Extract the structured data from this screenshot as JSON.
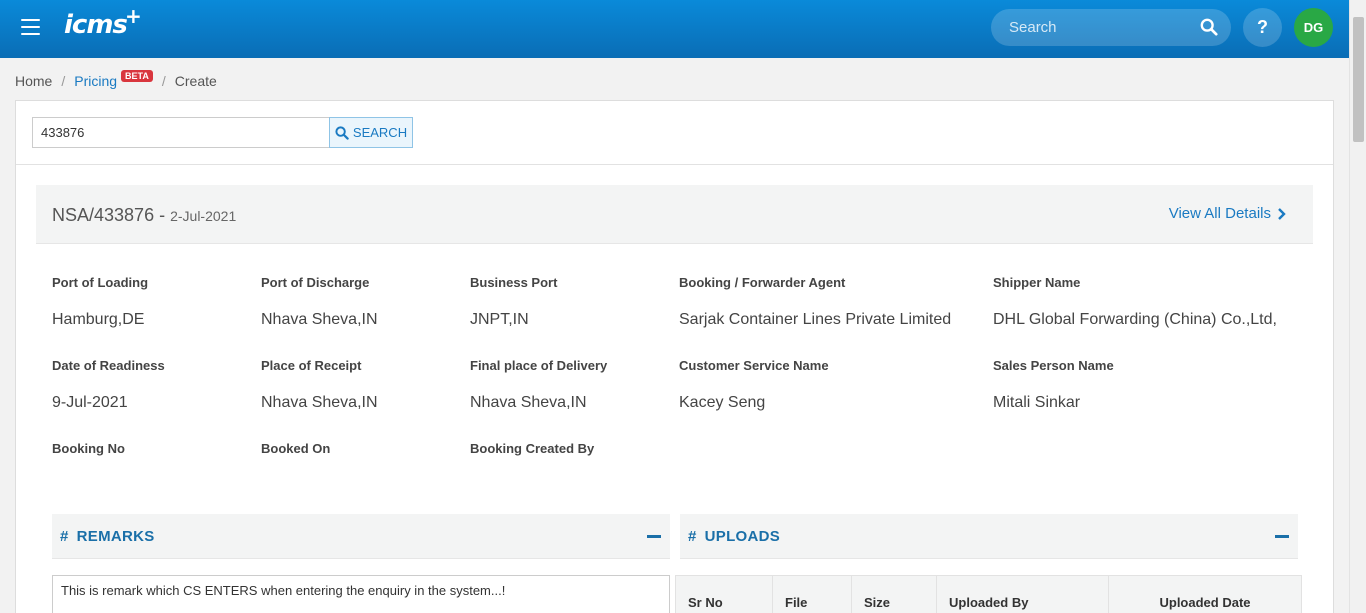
{
  "header": {
    "logo_text": "icms",
    "logo_plus": "+",
    "search_placeholder": "Search",
    "help_label": "?",
    "avatar_initials": "DG"
  },
  "breadcrumb": {
    "home": "Home",
    "pricing": "Pricing",
    "beta_badge": "BETA",
    "create": "Create",
    "separator": "/"
  },
  "search": {
    "value": "433876",
    "button_label": "SEARCH"
  },
  "record": {
    "id": "NSA/433876",
    "separator": " - ",
    "date": "2-Jul-2021",
    "view_all_label": "View All Details"
  },
  "fields": {
    "port_of_loading": {
      "label": "Port of Loading",
      "value": "Hamburg,DE"
    },
    "port_of_discharge": {
      "label": "Port of Discharge",
      "value": "Nhava Sheva,IN"
    },
    "business_port": {
      "label": "Business Port",
      "value": "JNPT,IN"
    },
    "booking_agent": {
      "label": "Booking / Forwarder Agent",
      "value": "Sarjak Container Lines Private Limited"
    },
    "shipper_name": {
      "label": "Shipper Name",
      "value": "DHL Global Forwarding (China) Co.,Ltd,"
    },
    "date_of_readiness": {
      "label": "Date of Readiness",
      "value": "9-Jul-2021"
    },
    "place_of_receipt": {
      "label": "Place of Receipt",
      "value": "Nhava Sheva,IN"
    },
    "final_place_of_delivery": {
      "label": "Final place of Delivery",
      "value": "Nhava Sheva,IN"
    },
    "customer_service_name": {
      "label": "Customer Service Name",
      "value": "Kacey Seng"
    },
    "sales_person_name": {
      "label": "Sales Person Name",
      "value": "Mitali Sinkar"
    },
    "booking_no": {
      "label": "Booking No",
      "value": ""
    },
    "booked_on": {
      "label": "Booked On",
      "value": ""
    },
    "booking_created_by": {
      "label": "Booking Created By",
      "value": ""
    }
  },
  "remarks": {
    "hash": "#",
    "title": "REMARKS",
    "text": "This is remark which CS ENTERS when entering the enquiry in the system...!"
  },
  "uploads": {
    "hash": "#",
    "title": "UPLOADS",
    "columns": [
      "Sr No",
      "File",
      "Size",
      "Uploaded By",
      "Uploaded Date"
    ]
  },
  "colors": {
    "header_bg": "#0a7ac8",
    "accent": "#1a7ac2",
    "beta_badge": "#d9363e",
    "avatar_bg": "#29a845"
  }
}
